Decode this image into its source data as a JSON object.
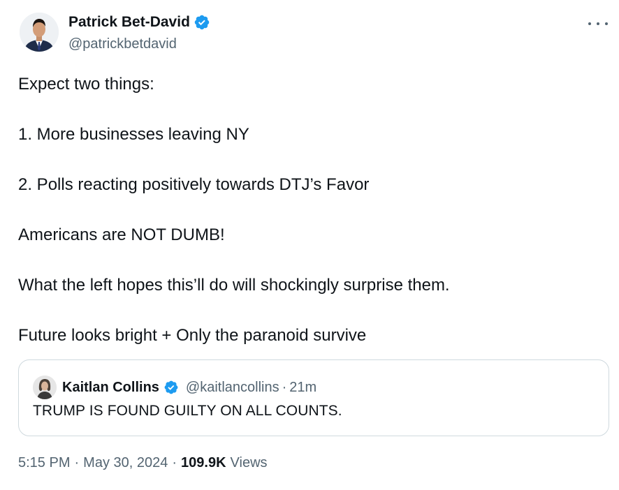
{
  "author": {
    "display_name": "Patrick Bet-David",
    "handle": "@patrickbetdavid",
    "verified": true
  },
  "menu": {
    "more_icon": "more-horizontal-icon"
  },
  "tweet": {
    "paragraphs": [
      "Expect two things:",
      "1.  More businesses leaving NY",
      "2.  Polls reacting positively towards DTJ’s Favor",
      "Americans are NOT DUMB!",
      "What the left hopes this’ll do will shockingly surprise them.",
      "Future looks bright + Only the paranoid survive"
    ]
  },
  "quoted_tweet": {
    "display_name": "Kaitlan Collins",
    "handle": "@kaitlancollins",
    "separator": "·",
    "time": "21m",
    "verified": true,
    "text": "TRUMP IS FOUND GUILTY ON ALL COUNTS."
  },
  "meta": {
    "time": "5:15 PM",
    "separator": "·",
    "date": "May 30, 2024",
    "views_count": "109.9K",
    "views_label": "Views"
  },
  "colors": {
    "text_primary": "#0f1419",
    "text_secondary": "#536471",
    "verified_blue": "#1d9bf0",
    "border": "#cfd9de"
  }
}
